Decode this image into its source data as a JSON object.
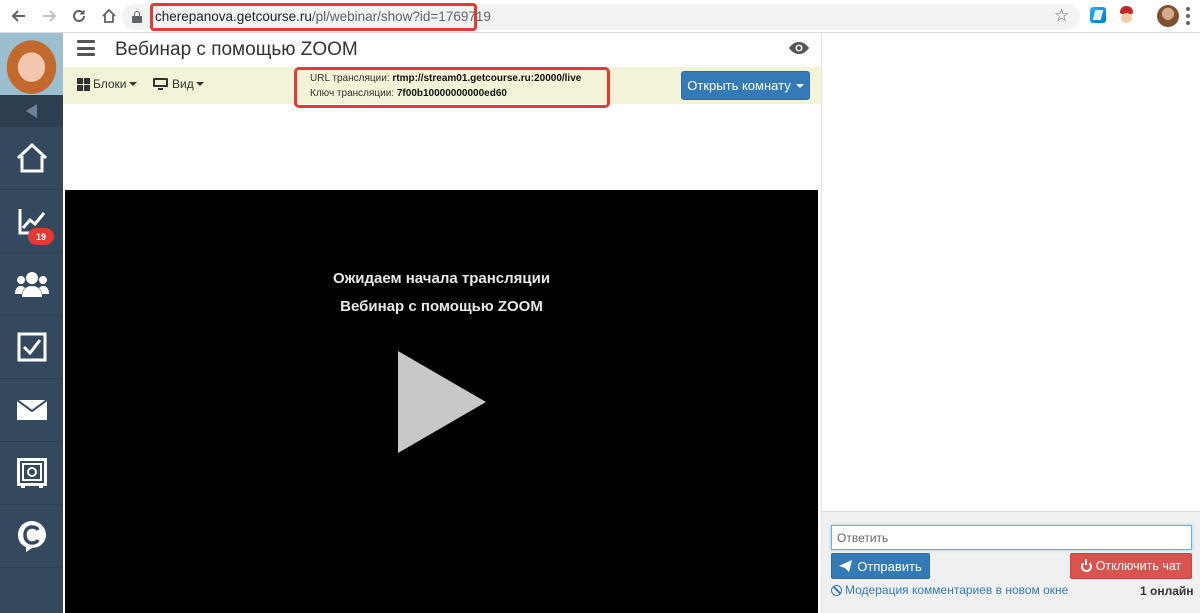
{
  "browser": {
    "url_host": "cherepanova.getcourse.ru",
    "url_path": "/pl/webinar/show?id=1769719"
  },
  "sidebar": {
    "notification_badge": "19",
    "items": [
      {
        "name": "home",
        "icon": "home-icon"
      },
      {
        "name": "statistics",
        "icon": "chart-icon"
      },
      {
        "name": "users",
        "icon": "users-icon"
      },
      {
        "name": "tasks",
        "icon": "checkbox-icon"
      },
      {
        "name": "messages",
        "icon": "envelope-icon"
      },
      {
        "name": "safe",
        "icon": "safe-icon"
      },
      {
        "name": "getcourse",
        "icon": "getcourse-logo-icon"
      }
    ]
  },
  "header": {
    "title": "Вебинар с помощью ZOOM"
  },
  "toolbar": {
    "blocks_label": "Блоки",
    "view_label": "Вид",
    "stream_url_label": "URL трансляции:",
    "stream_url_value": "rtmp://stream01.getcourse.ru:20000/live",
    "stream_key_label": "Ключ трансляции:",
    "stream_key_value": "7f00b10000000000ed60",
    "open_room_label": "Открыть комнату"
  },
  "video": {
    "status": "Ожидаем начала трансляции",
    "title": "Вебинар с помощью ZOOM"
  },
  "chat": {
    "reply_placeholder": "Ответить",
    "send_label": "Отправить",
    "disable_chat_label": "Отключить чат",
    "moderation_label": "Модерация комментариев в новом окне",
    "online_label": "1 онлайн"
  },
  "colors": {
    "sidebar_bg": "#34495e",
    "toolbar_bg": "#f3f3d7",
    "primary": "#337ab7",
    "danger": "#d9534f",
    "highlight": "#e53935"
  }
}
